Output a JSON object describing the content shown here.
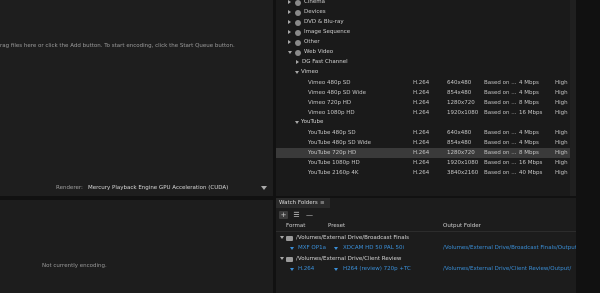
{
  "queue": {
    "hint": "rag files here or click the Add button.  To start encoding, click the Start Queue button.",
    "renderer_label": "Renderer:",
    "renderer_value": "Mercury Playback Engine GPU Acceleration (CUDA)"
  },
  "encoding": {
    "status": "Not currently encoding."
  },
  "presets": {
    "categories": [
      {
        "label": "Cinema",
        "icon": "globe-icon",
        "expanded": false
      },
      {
        "label": "Devices",
        "icon": "globe-icon",
        "expanded": false
      },
      {
        "label": "DVD & Blu-ray",
        "icon": "globe-icon",
        "expanded": false
      },
      {
        "label": "Image Sequence",
        "icon": "globe-icon",
        "expanded": false
      },
      {
        "label": "Other",
        "icon": "globe-icon",
        "expanded": false
      },
      {
        "label": "Web Video",
        "icon": "globe-icon",
        "expanded": true
      }
    ],
    "subgroups": {
      "dg": "DG Fast Channel",
      "vimeo": "Vimeo",
      "youtube": "YouTube"
    },
    "vimeo_rows": [
      {
        "name": "Vimeo 480p SD",
        "format": "H.264",
        "res": "640x480",
        "source": "Based on ...",
        "rate": "4 Mbps",
        "profile": "High"
      },
      {
        "name": "Vimeo 480p SD Wide",
        "format": "H.264",
        "res": "854x480",
        "source": "Based on ...",
        "rate": "4 Mbps",
        "profile": "High"
      },
      {
        "name": "Vimeo 720p HD",
        "format": "H.264",
        "res": "1280x720",
        "source": "Based on ...",
        "rate": "8 Mbps",
        "profile": "High"
      },
      {
        "name": "Vimeo 1080p HD",
        "format": "H.264",
        "res": "1920x1080",
        "source": "Based on ...",
        "rate": "16 Mbps",
        "profile": "High"
      }
    ],
    "youtube_rows": [
      {
        "name": "YouTube 480p SD",
        "format": "H.264",
        "res": "640x480",
        "source": "Based on ...",
        "rate": "4 Mbps",
        "profile": "High"
      },
      {
        "name": "YouTube 480p SD Wide",
        "format": "H.264",
        "res": "854x480",
        "source": "Based on ...",
        "rate": "4 Mbps",
        "profile": "High"
      },
      {
        "name": "YouTube 720p HD",
        "format": "H.264",
        "res": "1280x720",
        "source": "Based on ...",
        "rate": "8 Mbps",
        "profile": "High"
      },
      {
        "name": "YouTube 1080p HD",
        "format": "H.264",
        "res": "1920x1080",
        "source": "Based on ...",
        "rate": "16 Mbps",
        "profile": "High"
      },
      {
        "name": "YouTube 2160p 4K",
        "format": "H.264",
        "res": "3840x2160",
        "source": "Based on ...",
        "rate": "40 Mbps",
        "profile": "High"
      }
    ],
    "selected": "YouTube 720p HD"
  },
  "watch": {
    "tab_label": "Watch Folders",
    "tab_close": "≡",
    "toolbar": {
      "add": "+",
      "settings": "☰",
      "remove": "—"
    },
    "headers": {
      "format": "Format",
      "preset": "Preset",
      "output": "Output Folder"
    },
    "folders": [
      {
        "path": "/Volumes/External Drive/Broadcast Finals",
        "format": "MXF OP1a",
        "preset": "XDCAM HD 50 PAL 50i",
        "output": "/Volumes/External Drive/Broadcast Finals/Output/"
      },
      {
        "path": "/Volumes/External Drive/Client Review",
        "format": "H.264",
        "preset": "H264 (review) 720p +TC",
        "output": "/Volumes/External Drive/Client Review/Output/"
      }
    ]
  }
}
